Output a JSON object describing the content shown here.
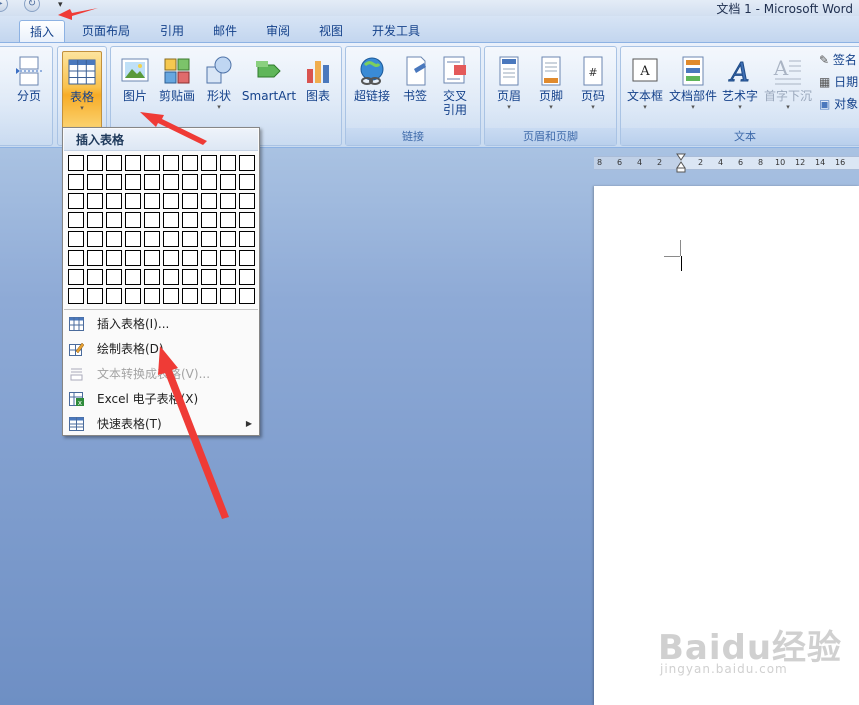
{
  "window": {
    "title": "文档 1 - Microsoft Word"
  },
  "tabs": [
    {
      "label": "插入",
      "active": true
    },
    {
      "label": "页面布局"
    },
    {
      "label": "引用"
    },
    {
      "label": "邮件"
    },
    {
      "label": "审阅"
    },
    {
      "label": "视图"
    },
    {
      "label": "开发工具"
    }
  ],
  "ribbon": {
    "page_break": "分页",
    "table": "表格",
    "picture": "图片",
    "clipart": "剪贴画",
    "shapes": "形状",
    "smartart": "SmartArt",
    "chart": "图表",
    "hyperlink": "超链接",
    "bookmark": "书签",
    "crossref": "交叉\n引用",
    "header": "页眉",
    "footer": "页脚",
    "page_number": "页码",
    "textbox": "文本框",
    "quickparts": "文档部件",
    "wordart": "艺术字",
    "dropcap": "首字下沉",
    "signature": "签名",
    "datetime": "日期",
    "object": "对象",
    "group_links": "链接",
    "group_headerfooter": "页眉和页脚",
    "group_text": "文本"
  },
  "table_menu": {
    "header": "插入表格",
    "items": [
      {
        "label": "插入表格(I)...",
        "icon": "insert-table-icon"
      },
      {
        "label": "绘制表格(D)",
        "icon": "draw-table-icon"
      },
      {
        "label": "文本转换成表格(V)...",
        "icon": "convert-text-icon",
        "disabled": true
      },
      {
        "label": "Excel 电子表格(X)",
        "icon": "excel-icon"
      },
      {
        "label": "快速表格(T)",
        "icon": "quick-table-icon",
        "submenu": true
      }
    ]
  },
  "ruler": {
    "ticks": [
      "8",
      "6",
      "4",
      "2",
      "2",
      "4",
      "6",
      "8",
      "10",
      "12",
      "14",
      "16"
    ]
  },
  "watermark": {
    "logo": "Baidu经验",
    "sub": "jingyan.baidu.com"
  },
  "colors": {
    "arrow": "#ef3b36",
    "highlight": "#f9c24e",
    "ribbon_text": "#15428b"
  }
}
